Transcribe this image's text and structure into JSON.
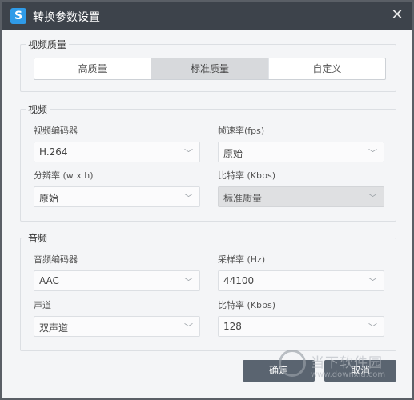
{
  "window": {
    "title": "转换参数设置",
    "app_icon_glyph": "S",
    "close_glyph": "✕"
  },
  "video_quality": {
    "group_title": "视频质量",
    "options": [
      "高质量",
      "标准质量",
      "自定义"
    ],
    "selected": "标准质量"
  },
  "video": {
    "group_title": "视频",
    "encoder_label": "视频编码器",
    "encoder_value": "H.264",
    "framerate_label": "帧速率(fps)",
    "framerate_value": "原始",
    "resolution_label": "分辨率 (w x h)",
    "resolution_value": "原始",
    "bitrate_label": "比特率 (Kbps)",
    "bitrate_value": "标准质量"
  },
  "audio": {
    "group_title": "音频",
    "encoder_label": "音频编码器",
    "encoder_value": "AAC",
    "samplerate_label": "采样率 (Hz)",
    "samplerate_value": "44100",
    "channel_label": "声道",
    "channel_value": "双声道",
    "bitrate_label": "比特率 (Kbps)",
    "bitrate_value": "128"
  },
  "buttons": {
    "ok": "确定",
    "cancel": "取消"
  },
  "watermark": {
    "text": "当下软件园",
    "url": "www.downxia.com"
  },
  "colors": {
    "titlebar": "#3d434b",
    "accent": "#2f9be8",
    "button": "#5a6470"
  }
}
